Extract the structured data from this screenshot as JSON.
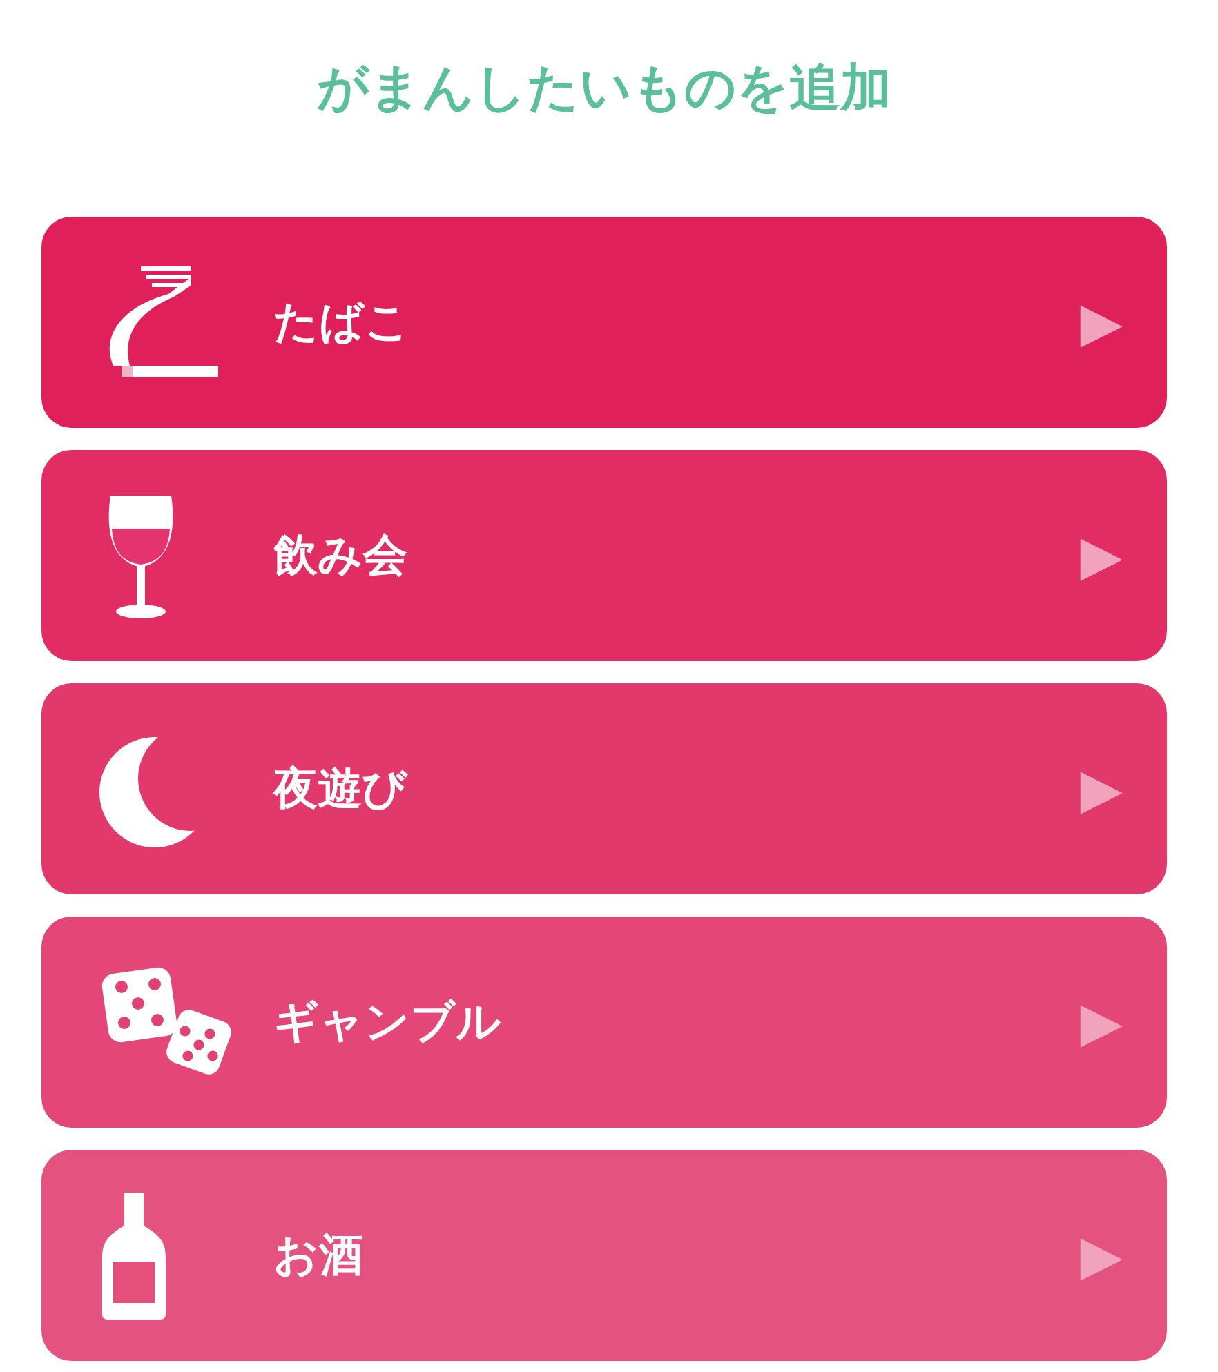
{
  "title": "がまんしたいものを追加",
  "items": [
    {
      "kind": "cigarette",
      "label": "たばこ",
      "arrow": "▶"
    },
    {
      "kind": "wine",
      "label": "飲み会",
      "arrow": "▶"
    },
    {
      "kind": "moon",
      "label": "夜遊び",
      "arrow": "▶"
    },
    {
      "kind": "dice",
      "label": "ギャンブル",
      "arrow": "▶"
    },
    {
      "kind": "bottle",
      "label": "お酒",
      "arrow": "▶"
    }
  ]
}
